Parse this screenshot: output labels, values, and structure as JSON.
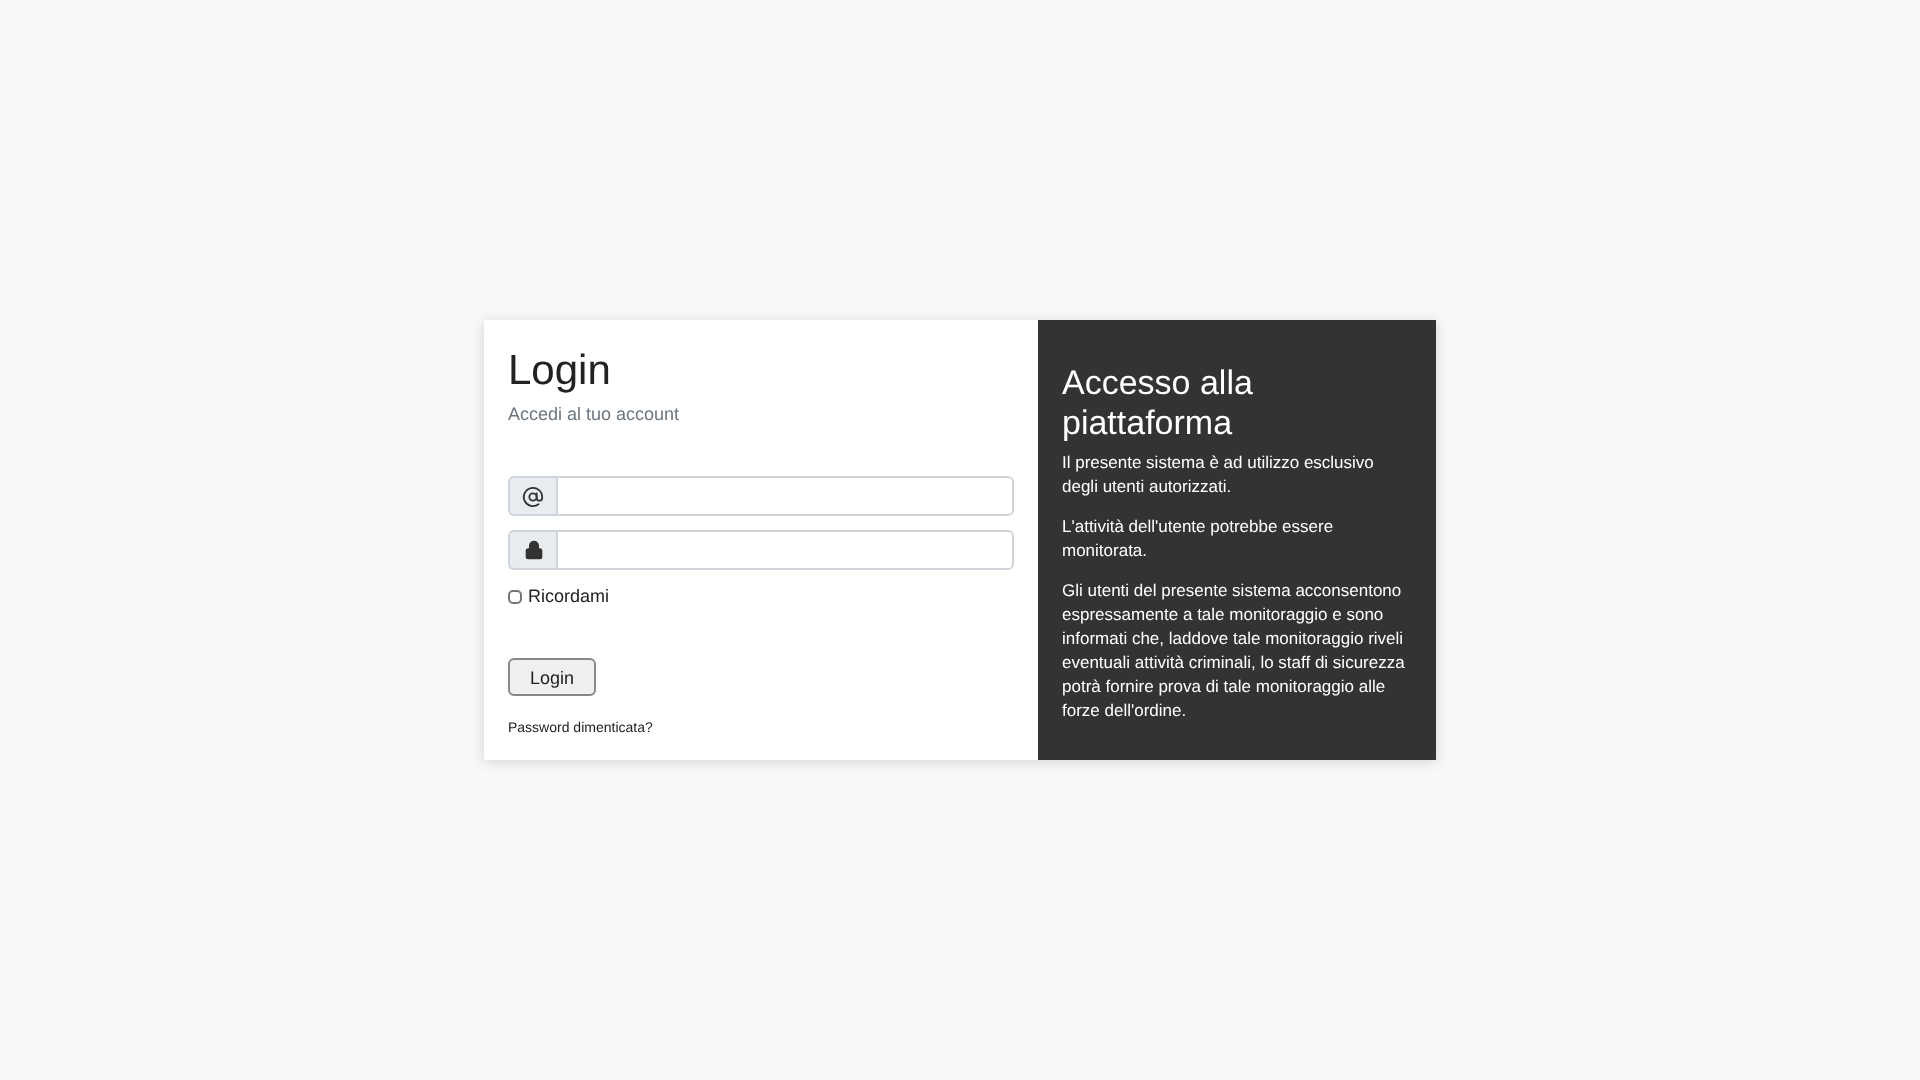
{
  "login": {
    "title": "Login",
    "subtitle": "Accedi al tuo account",
    "fields": [
      {
        "kind": "email"
      },
      {
        "kind": "password"
      }
    ],
    "remember": {
      "label": "Ricordami",
      "checked": false
    },
    "button": "Login",
    "forgot_link": "Password dimenticata?"
  },
  "info": {
    "title": "Accesso alla piattaforma",
    "paragraphs": [
      "Il presente sistema è ad utilizzo esclusivo degli utenti autorizzati.",
      "L'attività dell'utente potrebbe essere monitorata.",
      "Gli utenti del presente sistema acconsentono espressamente a tale monitoraggio e sono informati che, laddove tale monitoraggio riveli eventuali attività criminali, lo staff di sicurezza potrà fornire prova di tale monitoraggio alle forze dell'ordine."
    ]
  }
}
